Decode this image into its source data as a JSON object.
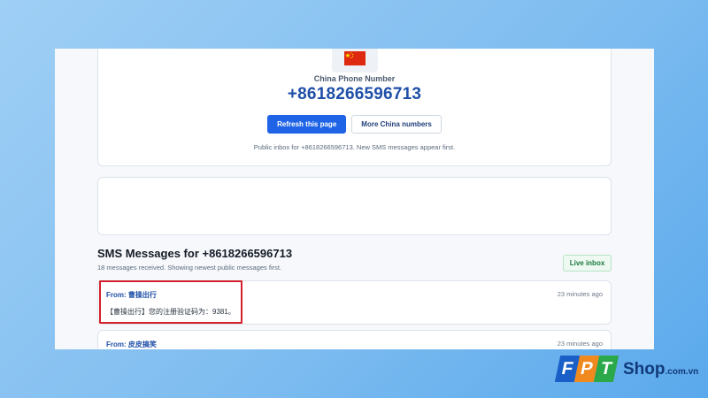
{
  "hero": {
    "flag_icon": "china-flag-icon",
    "label": "China Phone Number",
    "number": "+8618266596713",
    "refresh_label": "Refresh this page",
    "more_label": "More China numbers",
    "note": "Public inbox for +8618266596713. New SMS messages appear first."
  },
  "sms": {
    "title": "SMS Messages for +8618266596713",
    "subtitle": "18 messages received. Showing newest public messages first.",
    "live_label": "Live inbox",
    "messages": [
      {
        "from": "From: 曹操出行",
        "time": "23 minutes ago",
        "body": "【曹操出行】您的注册验证码为：9381。"
      },
      {
        "from": "From: 皮皮搞笑",
        "time": "23 minutes ago",
        "body": ""
      }
    ]
  },
  "logo": {
    "tiles": [
      "F",
      "P",
      "T"
    ],
    "shop": "Shop",
    "domain": ".com.vn"
  },
  "colors": {
    "primary": "#1f63e6",
    "number": "#1f4fa8",
    "highlight": "#d3212c",
    "tile_f": "#1a5fc8",
    "tile_p": "#f08a1e",
    "tile_t": "#2aa84a"
  }
}
